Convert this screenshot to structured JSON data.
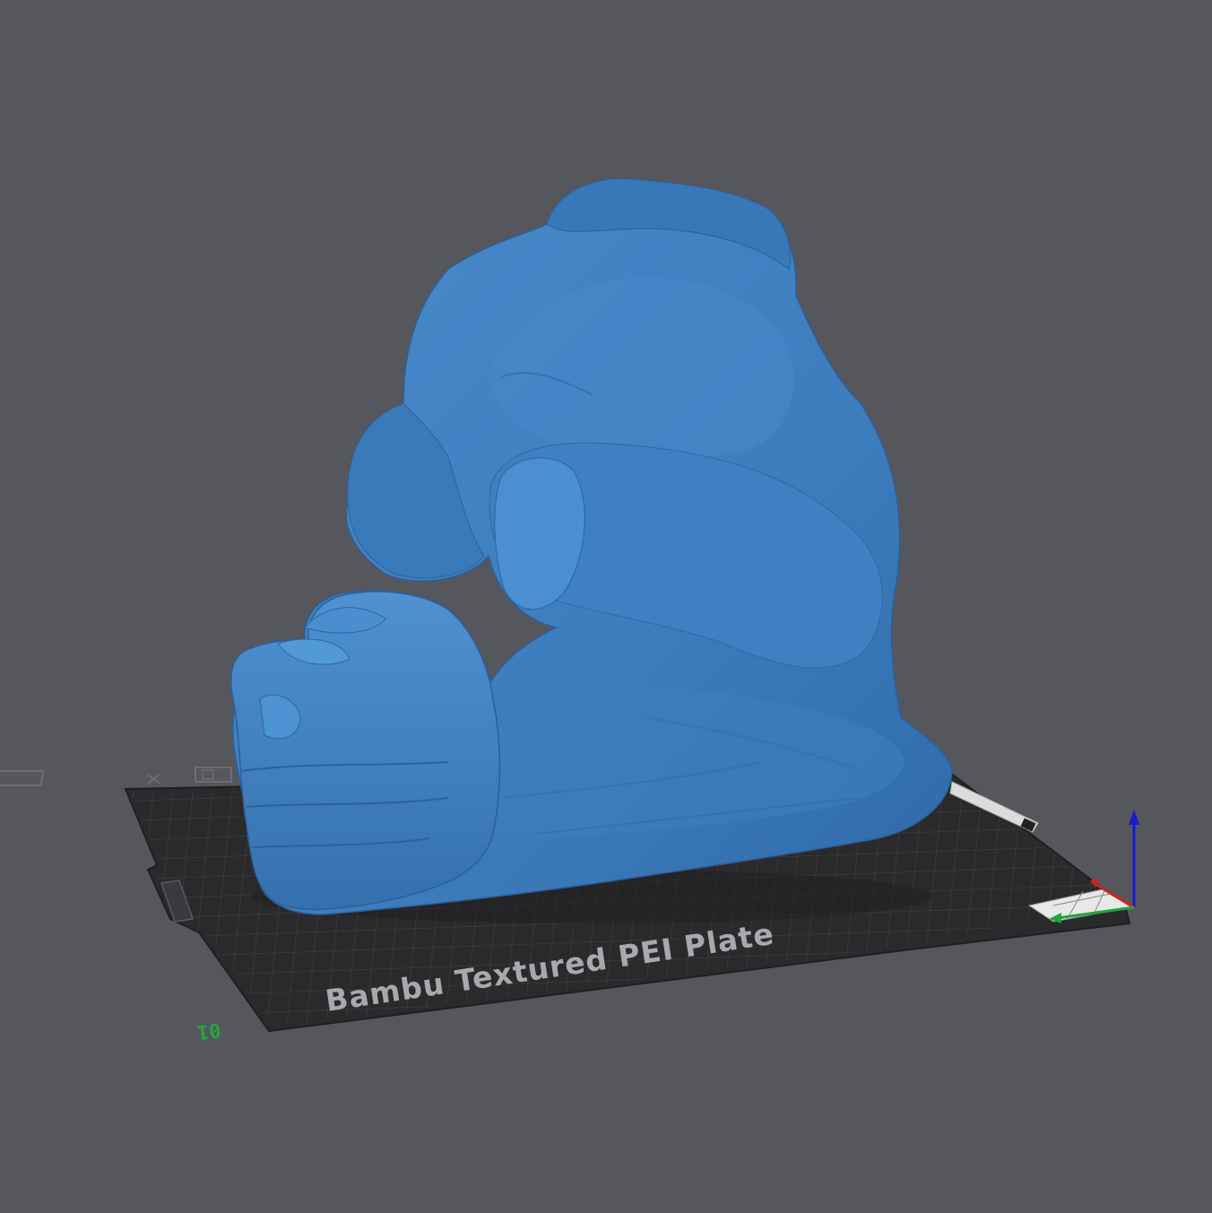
{
  "viewport": {
    "background_color": "#56565d",
    "plate": {
      "label": "Bambu Textured PEI Plate",
      "plate_number": "01",
      "plate_color": "#2a2a2c",
      "grid_color": "#4a4a4e",
      "label_color": "#a9a9ad",
      "icons": [
        "close-plate-icon",
        "arrange-plate-icon"
      ]
    },
    "model": {
      "color": "#3f7fc0",
      "shape": "flexed-arm-bicep"
    },
    "axes": {
      "x_color": "#d02020",
      "y_color": "#1fa63a",
      "z_color": "#1a1ad0"
    }
  }
}
